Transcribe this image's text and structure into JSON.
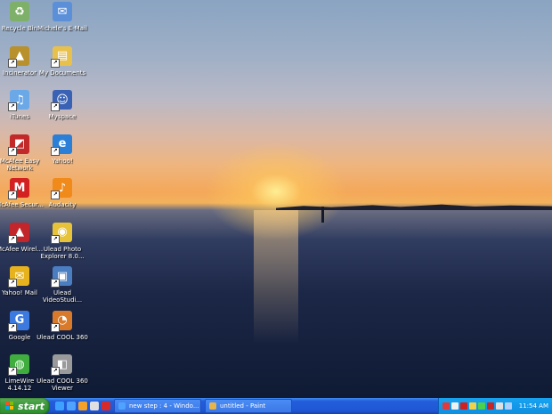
{
  "desktop": {
    "icons": [
      {
        "label": "Recycle Bin",
        "icon": "recycle-bin-icon",
        "color": "#7fb06a",
        "glyph": "♻"
      },
      {
        "label": "Michele's E-Mail",
        "icon": "email-icon",
        "color": "#5b8fd8",
        "glyph": "✉"
      },
      {
        "label": "Incinerator",
        "icon": "incinerator-icon",
        "color": "#b8902c",
        "glyph": "▲"
      },
      {
        "label": "My Documents",
        "icon": "my-documents-icon",
        "color": "#e8c14d",
        "glyph": "▤"
      },
      {
        "label": "iTunes",
        "icon": "itunes-icon",
        "color": "#6aa8e8",
        "glyph": "♫"
      },
      {
        "label": "Myspace",
        "icon": "myspace-icon",
        "color": "#3a62b4",
        "glyph": "☺"
      },
      {
        "label": "McAfee Easy Network",
        "icon": "mcafee-network-icon",
        "color": "#c22a2a",
        "glyph": "◩"
      },
      {
        "label": "Yahoo!",
        "icon": "yahoo-browser-icon",
        "color": "#2b7fd6",
        "glyph": "e"
      },
      {
        "label": "McAfee Secur...",
        "icon": "mcafee-security-icon",
        "color": "#d32020",
        "glyph": "M"
      },
      {
        "label": "Audacity",
        "icon": "audacity-icon",
        "color": "#f08a1a",
        "glyph": "♪"
      },
      {
        "label": "McAfee Wirel...",
        "icon": "mcafee-wireless-icon",
        "color": "#c2262a",
        "glyph": "▲"
      },
      {
        "label": "Ulead Photo Explorer 8.0...",
        "icon": "ulead-photo-explorer-icon",
        "color": "#e7c33a",
        "glyph": "◉"
      },
      {
        "label": "Yahoo! Mail",
        "icon": "yahoo-mail-icon",
        "color": "#e6b21e",
        "glyph": "✉"
      },
      {
        "label": "Ulead VideoStudi...",
        "icon": "ulead-videostudio-icon",
        "color": "#4a7ec0",
        "glyph": "▣"
      },
      {
        "label": "Google",
        "icon": "google-icon",
        "color": "#3c7ae0",
        "glyph": "G"
      },
      {
        "label": "Ulead COOL 360",
        "icon": "ulead-cool-360-icon",
        "color": "#d87a2a",
        "glyph": "◔"
      },
      {
        "label": "LimeWire 4.14.12",
        "icon": "limewire-icon",
        "color": "#3fae3f",
        "glyph": "◍"
      },
      {
        "label": "Ulead COOL 360 Viewer",
        "icon": "ulead-cool-360-viewer-icon",
        "color": "#9a9a9a",
        "glyph": "◧"
      }
    ]
  },
  "taskbar": {
    "start_label": "start",
    "quick_launch": [
      {
        "icon": "show-desktop-icon",
        "color": "#3ea0ff"
      },
      {
        "icon": "internet-explorer-icon",
        "color": "#4fa3ff"
      },
      {
        "icon": "media-player-icon",
        "color": "#f4a12a"
      },
      {
        "icon": "email-client-icon",
        "color": "#e0e0e0"
      },
      {
        "icon": "mcafee-quick-icon",
        "color": "#d62a2a"
      }
    ],
    "tasks": [
      {
        "label": "new step : 4 - Windo...",
        "icon": "internet-explorer-icon",
        "color": "#4fa3ff"
      },
      {
        "label": "untitled - Paint",
        "icon": "paint-icon",
        "color": "#e7b54a"
      }
    ],
    "tray": [
      {
        "icon": "network-icon",
        "color": "#e23a3a"
      },
      {
        "icon": "volume-icon",
        "color": "#f0f0f0"
      },
      {
        "icon": "security-icon",
        "color": "#d02020"
      },
      {
        "icon": "update-icon",
        "color": "#f0d24a"
      },
      {
        "icon": "messenger-icon",
        "color": "#4bd14b"
      },
      {
        "icon": "antivirus-icon",
        "color": "#c82525"
      },
      {
        "icon": "wireless-icon",
        "color": "#e0e0e0"
      },
      {
        "icon": "battery-icon",
        "color": "#b0d0ff"
      }
    ],
    "clock": "11:54 AM"
  }
}
